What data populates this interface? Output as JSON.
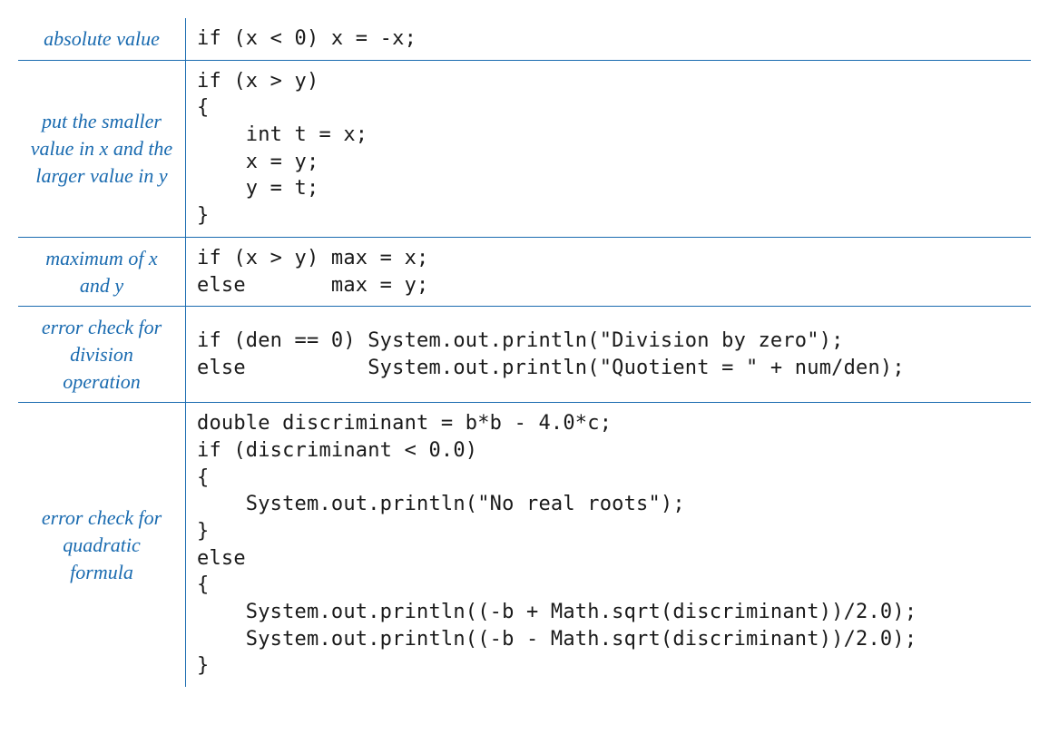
{
  "rows": [
    {
      "label": "absolute value",
      "code": "if (x < 0) x = -x;"
    },
    {
      "label": "put the smaller\nvalue in x\nand the larger\nvalue in y",
      "code": "if (x > y)\n{\n    int t = x;\n    x = y;\n    y = t;\n}"
    },
    {
      "label": "maximum of\nx and y",
      "code": "if (x > y) max = x;\nelse       max = y;"
    },
    {
      "label": "error check\nfor division\noperation",
      "code": "if (den == 0) System.out.println(\"Division by zero\");\nelse          System.out.println(\"Quotient = \" + num/den);"
    },
    {
      "label": "error check\nfor quadratic\nformula",
      "code": "double discriminant = b*b - 4.0*c;\nif (discriminant < 0.0)\n{\n    System.out.println(\"No real roots\");\n}\nelse\n{\n    System.out.println((-b + Math.sqrt(discriminant))/2.0);\n    System.out.println((-b - Math.sqrt(discriminant))/2.0);\n}"
    }
  ]
}
